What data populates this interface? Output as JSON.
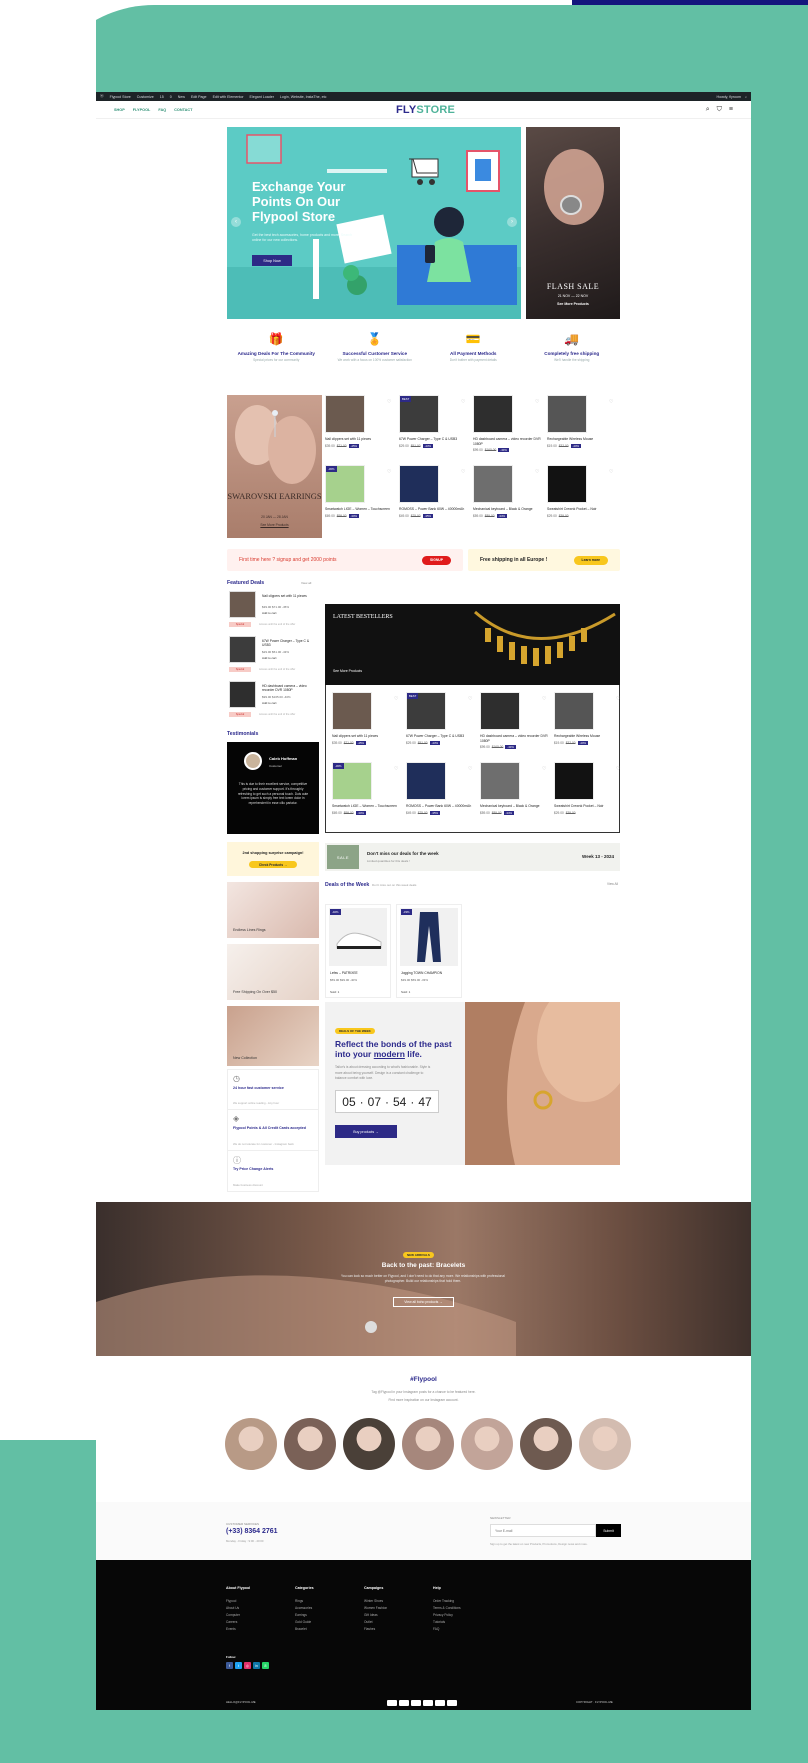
{
  "admin_bar": {
    "items": [
      "Flypool Store",
      "Customize",
      "15",
      "0",
      "New",
      "Edit Page",
      "Edit with Elementor",
      "Elegant Loader",
      "Login, Website, InstaThe, etc"
    ],
    "user": "Howdy, flyroom"
  },
  "nav": {
    "links": [
      "SHOP",
      "FLYPOOL",
      "FAQ",
      "CONTACT"
    ],
    "logo_a": "FLY",
    "logo_b": "STORE"
  },
  "hero": {
    "title": "Exchange Your Points On Our Flypool Store",
    "subtitle": "Get the best tech accessories, home products and more. Search online for our new collections.",
    "button": "Shop Now"
  },
  "flash": {
    "title": "FLASH SALE",
    "date": "21 NOV — 22 NOV",
    "link": "See More Products"
  },
  "features": [
    {
      "icon": "gift-box-icon",
      "glyph": "🎁",
      "title": "Amazing Deals For The Community",
      "desc": "Special prices for our community"
    },
    {
      "icon": "award-medal-icon",
      "glyph": "🏅",
      "title": "Successful Customer Service",
      "desc": "We work with a focus on 100% customer satisfaction"
    },
    {
      "icon": "credit-card-icon",
      "glyph": "💳",
      "title": "All Payment Methods",
      "desc": "Don't bother with payment details"
    },
    {
      "icon": "delivery-truck-icon",
      "glyph": "🚚",
      "title": "Completely free shipping",
      "desc": "We'll handle the shipping"
    }
  ],
  "swarovski": {
    "title": "SWAROVSKI EARRINGS",
    "date": "20 JAN — 28 JAN",
    "link": "See More Products"
  },
  "products": [
    {
      "name": "Nail clippers set with 11 pieces",
      "price": "$39.00",
      "old": "$71.00",
      "off": "-45%",
      "badge": "",
      "color": "#6b5a4f"
    },
    {
      "name": "67W Power Charger – Type C & USB3",
      "price": "$29.00",
      "old": "$51.00",
      "off": "-43%",
      "badge": "BEST",
      "color": "#3c3c3c"
    },
    {
      "name": "HD dashboard camera – video recorder DVR 1080P",
      "price": "$99.00",
      "old": "$165.00",
      "off": "-40%",
      "badge": "",
      "color": "#2e2e2e"
    },
    {
      "name": "Rechargeable Wireless Mouse",
      "price": "$19.00",
      "old": "$32.00",
      "off": "-40%",
      "badge": "",
      "color": "#555"
    },
    {
      "name": "Smartwatch LIGE – Women – Touchscreen",
      "price": "$69.00",
      "old": "$99.00",
      "off": "-30%",
      "badge": "-30%",
      "color": "#a6d18d"
    },
    {
      "name": "ROMOSS – Power Bank 60W – 40000mAh",
      "price": "$49.00",
      "old": "$75.00",
      "off": "-35%",
      "badge": "",
      "color": "#1f2e5a"
    },
    {
      "name": "Mechanical keyboard – Black & Orange",
      "price": "$59.00",
      "old": "$89.00",
      "off": "-34%",
      "badge": "",
      "color": "#6e6e6e"
    },
    {
      "name": "Sweatshirt Crewnk Pocket – Noir",
      "price": "$29.00",
      "old": "$39.00",
      "off": "",
      "badge": "",
      "color": "#121212"
    }
  ],
  "promo1": {
    "text": "First time here ? signup and get 2000 points",
    "button": "SIGNUP"
  },
  "promo2": {
    "text": "Free shipping in all Europe !",
    "button": "Learn more"
  },
  "featured": {
    "title": "Featured Deals",
    "view_all": "View all",
    "items": [
      {
        "name": "Nail clippers set with 11 pieces",
        "price": "$39.00 $71.00 -45%",
        "cart": "Add to cart",
        "bar": "Special",
        "note": "Access until the end of the offer"
      },
      {
        "name": "67W Power Charger – Type C & USB3",
        "price": "$29.00 $51.00 -43%",
        "cart": "Add to cart",
        "bar": "Special",
        "note": "Access until the end of the offer"
      },
      {
        "name": "HD dashboard camera – video recorder DVR 1080P",
        "price": "$99.00 $165.00 -40%",
        "cart": "Add to cart",
        "bar": "Special",
        "note": "Access until the end of the offer"
      }
    ]
  },
  "testimonials": {
    "title": "Testimonials",
    "name": "Caleb Hoffman",
    "role": "Customer",
    "text": "This is due to their excellent service, competitive pricing and customer support. It's throughly refreshing to get such a personal touch. Duis aute lorem ipsum is simply free text lorem dolor in reprehenderit in esse cillu pariatur."
  },
  "bestsellers": {
    "title": "LATEST BESTELLERS",
    "link": "See More Products"
  },
  "campaign": {
    "title": "2nd shopping surprise campaign!",
    "button": "Check Products →"
  },
  "week": {
    "sale": "SALE",
    "title": "Don't miss our deals for the week",
    "sub": "Limited quantities for this deals !",
    "right": "Week 13 - 2024"
  },
  "deals_week": {
    "title": "Deals of the Week",
    "sub": "Don't miss out on this week deals",
    "view_all": "View All",
    "items": [
      {
        "name": "Lefeu – PATRIXEE",
        "price": "$59.00 $99.00 -40%",
        "sold": "Sold: 1",
        "badge": "-40%"
      },
      {
        "name": "Jogging TOWN CHAMPION",
        "price": "$39.00 $59.00 -33%",
        "sold": "Sold: 1",
        "badge": "-33%"
      }
    ]
  },
  "side_banners": [
    {
      "label": "Endless Lines Rings"
    },
    {
      "label": "Free Shipping On Over $50"
    },
    {
      "label": "New Collection"
    }
  ],
  "reflect": {
    "tag": "DEALS OF THE WEEK",
    "title_a": "Reflect the bonds of the past into your",
    "title_b": "modern",
    "title_c": "life.",
    "desc": "Tailor's is about dressing according to what's fashionable. Style is more about being yourself. Design is a constant challenge to balance comfort with luxe.",
    "timer": [
      "05",
      "07",
      "54",
      "47"
    ],
    "button": "Buy products →"
  },
  "services": [
    {
      "icon": "clock-icon",
      "glyph": "◷",
      "title": "24 hour fast customer service",
      "desc": "We support online reading - Any hour"
    },
    {
      "icon": "trophy-icon",
      "glyph": "◈",
      "title": "Flypool Points & All Credit Cards accepted",
      "desc": "We do not tolerate for customer - Instagram back"
    },
    {
      "icon": "info-icon",
      "glyph": "ⓘ",
      "title": "Try Price Change Alerts",
      "desc": "Make business discount"
    }
  ],
  "bracelets": {
    "tag": "NEW ARRIVALS",
    "title": "Back to the past: Bracelets",
    "desc": "You can look so much better on Flypool, and I don't need to do that any more. We relationships with professional photographer. Build our relationships that hold them.",
    "button": "View all boho products →"
  },
  "insta": {
    "title": "#Flypool",
    "line1": "Tag @Flypool in your Instagram posts for a chance to be featured here.",
    "line2": "Find more inspiration on our Instagram account.",
    "avatar_colors": [
      "#b89a86",
      "#7a6157",
      "#4a4038",
      "#a6877c",
      "#c2a499",
      "#6e5a50",
      "#d3bcb0"
    ]
  },
  "contact": {
    "label": "CUSTOMER SERVICES",
    "phone": "(+33) 8364 2761",
    "hours": "Monday - Friday : 9:00 - 20:00",
    "newsletter": "NEWSLETTER",
    "placeholder": "Your E-mail",
    "submit": "Submit",
    "note": "Sign up to get the latest on new Products, Promotions, Design news and more."
  },
  "footer": {
    "cols": [
      {
        "h": "About Flypool",
        "l": [
          "Flypool",
          "About Us",
          "Computer",
          "Careers",
          "Events"
        ]
      },
      {
        "h": "Categories",
        "l": [
          "Rings",
          "Accessories",
          "Earrings",
          "Gold Guide",
          "Bracelet"
        ]
      },
      {
        "h": "Campaigns",
        "l": [
          "Winter Shoes",
          "Women Fashion",
          "Gift Ideas",
          "Outlet",
          "Flashes"
        ]
      },
      {
        "h": "Help",
        "l": [
          "Order Tracking",
          "Terms & Conditions",
          "Privacy Policy",
          "Tutorials",
          "FAQ"
        ]
      }
    ],
    "follow": "Follow",
    "email": "HELLO@FLYPOOL.ME",
    "copyright": "COPYRIGHT · FLYPOOL.ME"
  },
  "colors": {
    "brand_navy": "#2c2a8c",
    "brand_teal": "#4fb39a",
    "accent_yellow": "#f8c71d",
    "frame_teal": "#62bfa4",
    "corner_navy": "#14157d"
  }
}
